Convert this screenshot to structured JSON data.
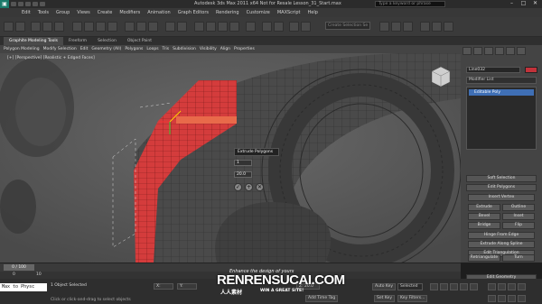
{
  "title_bar": {
    "app_title": "Autodesk 3ds Max  2011 x64    Not for Resale    Lesson_31_Start.max",
    "search_placeholder": "Type a keyword or phrase",
    "minimize": "–",
    "maximize": "□",
    "close": "✕"
  },
  "menu": [
    "Edit",
    "Tools",
    "Group",
    "Views",
    "Create",
    "Modifiers",
    "Animation",
    "Graph Editors",
    "Rendering",
    "Customize",
    "MAXScript",
    "Help"
  ],
  "toolbar": {
    "selection_set_placeholder": "Create Selection Se"
  },
  "ribbon": {
    "tabs": [
      "Graphite Modeling Tools",
      "Freeform",
      "Selection",
      "Object Paint"
    ],
    "panels": [
      "Polygon Modeling",
      "Modify Selection",
      "Edit",
      "Geometry (All)",
      "Polygons",
      "Loops",
      "Tris",
      "Subdivision",
      "Visibility",
      "Align",
      "Properties"
    ]
  },
  "viewport": {
    "label": "[+] [Perspective] [Realistic + Edged Faces]",
    "caddy_title": "Extrude Polygons",
    "value_1": "1",
    "value_2": "0",
    "value_3": "20.0",
    "ok": "✓",
    "apply": "+",
    "cancel": "✕"
  },
  "command_panel": {
    "object_name": "Line032",
    "object_color": "#c2323a",
    "modifier_list": "Modifier List",
    "stack_items": [
      "Editable Poly"
    ],
    "rollouts": {
      "soft_selection": "Soft Selection",
      "edit_polygons": "Edit Polygons",
      "insert_vertex": "Insert Vertex",
      "extrude": "Extrude",
      "outline": "Outline",
      "bevel": "Bevel",
      "inset": "Inset",
      "bridge": "Bridge",
      "flip": "Flip",
      "hinge_from_edge": "Hinge From Edge",
      "extrude_along_spline": "Extrude Along Spline",
      "edit_triangulation": "Edit Triangulation",
      "retriangulate": "Retriangulate",
      "turn": "Turn",
      "edit_geometry": "Edit Geometry"
    }
  },
  "timeline": {
    "slider": "0 / 100",
    "ruler_start": "0",
    "ruler_10": "10"
  },
  "status": {
    "maxscript": "Max to Physc",
    "selection": "1 Object Selected",
    "prompt": "Click or click-and-drag to select objects",
    "x": "X:",
    "y": "Y:",
    "z": "Z: 20.0",
    "auto_key": "Auto Key",
    "selected": "Selected",
    "set_key": "Set Key",
    "key_filters": "Key Filters...",
    "add_time_tag": "Add Time Tag"
  },
  "watermark": {
    "tagline": "Enhance the design of yours",
    "site": "RENRENSUCAI.COM",
    "cn": "人人素材",
    "sub": "WIN A GREAT SITE!"
  }
}
